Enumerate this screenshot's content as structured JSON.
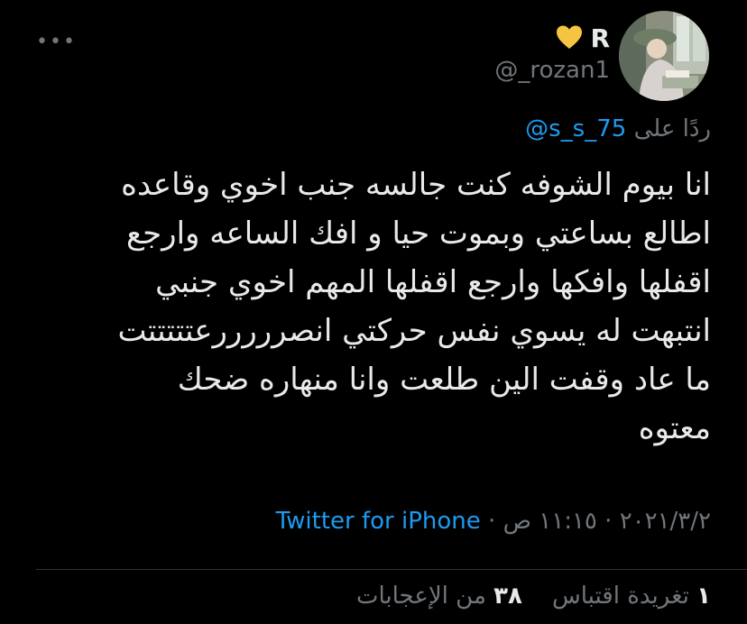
{
  "tweet": {
    "more_icon": "more-horizontal-icon",
    "avatar_icon": "avatar-image",
    "name": "R",
    "badge_icon": "yellow-heart-icon",
    "handle": "@_rozan1",
    "reply_prefix": "ردًا على",
    "reply_to": "@s_s_75",
    "lines": [
      "انا بيوم الشوفه كنت جالسه جنب اخوي وقاعده",
      "اطالع بساعتي وبموت حيا و افك الساعه وارجع",
      "اقفلها وافكها وارجع اقفلها المهم اخوي جنبي",
      "انتبهت له يسوي نفس حركتي انصرررررعتتتتتت",
      "ما عاد وقفت الين طلعت وانا منهاره ضحك",
      "معتوه"
    ],
    "date": "٢٠٢١/٣/٢",
    "time": "١١:١٥ ص",
    "source": "Twitter for iPhone",
    "quote_count": "١",
    "quote_label": "تغريدة اقتباس",
    "like_count": "٣٨",
    "like_label": "من الإعجابات"
  },
  "colors": {
    "background": "#000000",
    "text": "#e7e9ea",
    "secondary": "#71767b",
    "link": "#1d9bf0",
    "heart": "#f5c542"
  }
}
